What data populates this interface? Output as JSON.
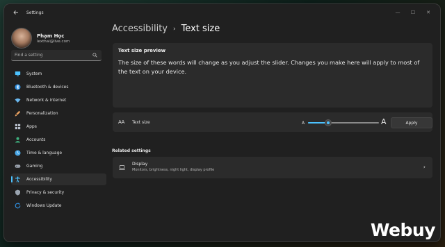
{
  "window": {
    "title": "Settings"
  },
  "window_controls": {
    "minimize": "—",
    "maximize": "☐",
    "close": "✕"
  },
  "profile": {
    "name": "Phạm Học",
    "email": "lexthai@live.com"
  },
  "search": {
    "placeholder": "Find a setting"
  },
  "sidebar": {
    "items": [
      {
        "label": "System",
        "icon": "monitor-icon",
        "color": "#4cc2ff"
      },
      {
        "label": "Bluetooth & devices",
        "icon": "bluetooth-icon",
        "color": "#2f8fe0"
      },
      {
        "label": "Network & internet",
        "icon": "wifi-icon",
        "color": "#6ab8f0"
      },
      {
        "label": "Personalization",
        "icon": "brush-icon",
        "color": "#e8a060"
      },
      {
        "label": "Apps",
        "icon": "apps-icon",
        "color": "#b8c0cc"
      },
      {
        "label": "Accounts",
        "icon": "person-icon",
        "color": "#3fb27f"
      },
      {
        "label": "Time & language",
        "icon": "globe-clock-icon",
        "color": "#4aa8e8"
      },
      {
        "label": "Gaming",
        "icon": "controller-icon",
        "color": "#a0a8b4"
      },
      {
        "label": "Accessibility",
        "icon": "accessibility-icon",
        "color": "#4cc2ff",
        "active": true
      },
      {
        "label": "Privacy & security",
        "icon": "shield-icon",
        "color": "#9aa4b0"
      },
      {
        "label": "Windows Update",
        "icon": "update-icon",
        "color": "#2f8fe0"
      }
    ]
  },
  "breadcrumb": {
    "parent": "Accessibility",
    "separator": "›",
    "current": "Text size"
  },
  "preview": {
    "title": "Text size preview",
    "text": "The size of these words will change as you adjust the slider. Changes you make here will apply to most of the text on your device."
  },
  "text_size": {
    "icon": "text-size-icon",
    "glyph": "AA",
    "label": "Text size",
    "min_label": "A",
    "max_label": "A",
    "slider_fraction": 0.27,
    "apply_label": "Apply"
  },
  "related": {
    "heading": "Related settings",
    "display": {
      "title": "Display",
      "subtitle": "Monitors, brightness, night light, display profile",
      "icon": "laptop-icon",
      "chevron": "›"
    }
  },
  "watermark": {
    "text": "Webuy"
  },
  "colors": {
    "accent": "#4cc2ff",
    "window_bg": "#202020",
    "card_bg": "#2b2b2b"
  }
}
